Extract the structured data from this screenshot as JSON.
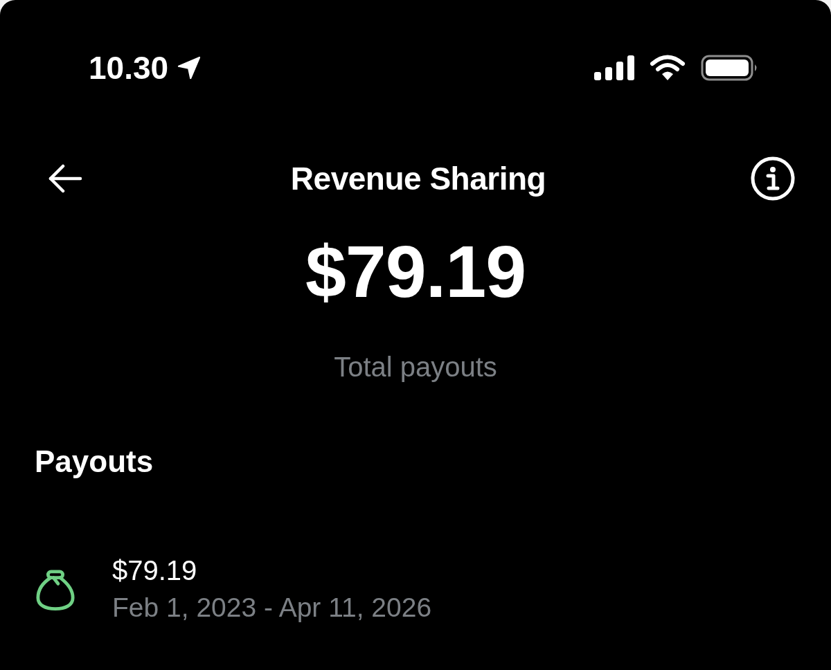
{
  "status_bar": {
    "time": "10.30"
  },
  "header": {
    "title": "Revenue Sharing"
  },
  "summary": {
    "amount": "$79.19",
    "label": "Total payouts"
  },
  "payouts": {
    "heading": "Payouts",
    "items": [
      {
        "amount": "$79.19",
        "period": "Feb 1, 2023 - Apr 11, 2026"
      }
    ]
  }
}
